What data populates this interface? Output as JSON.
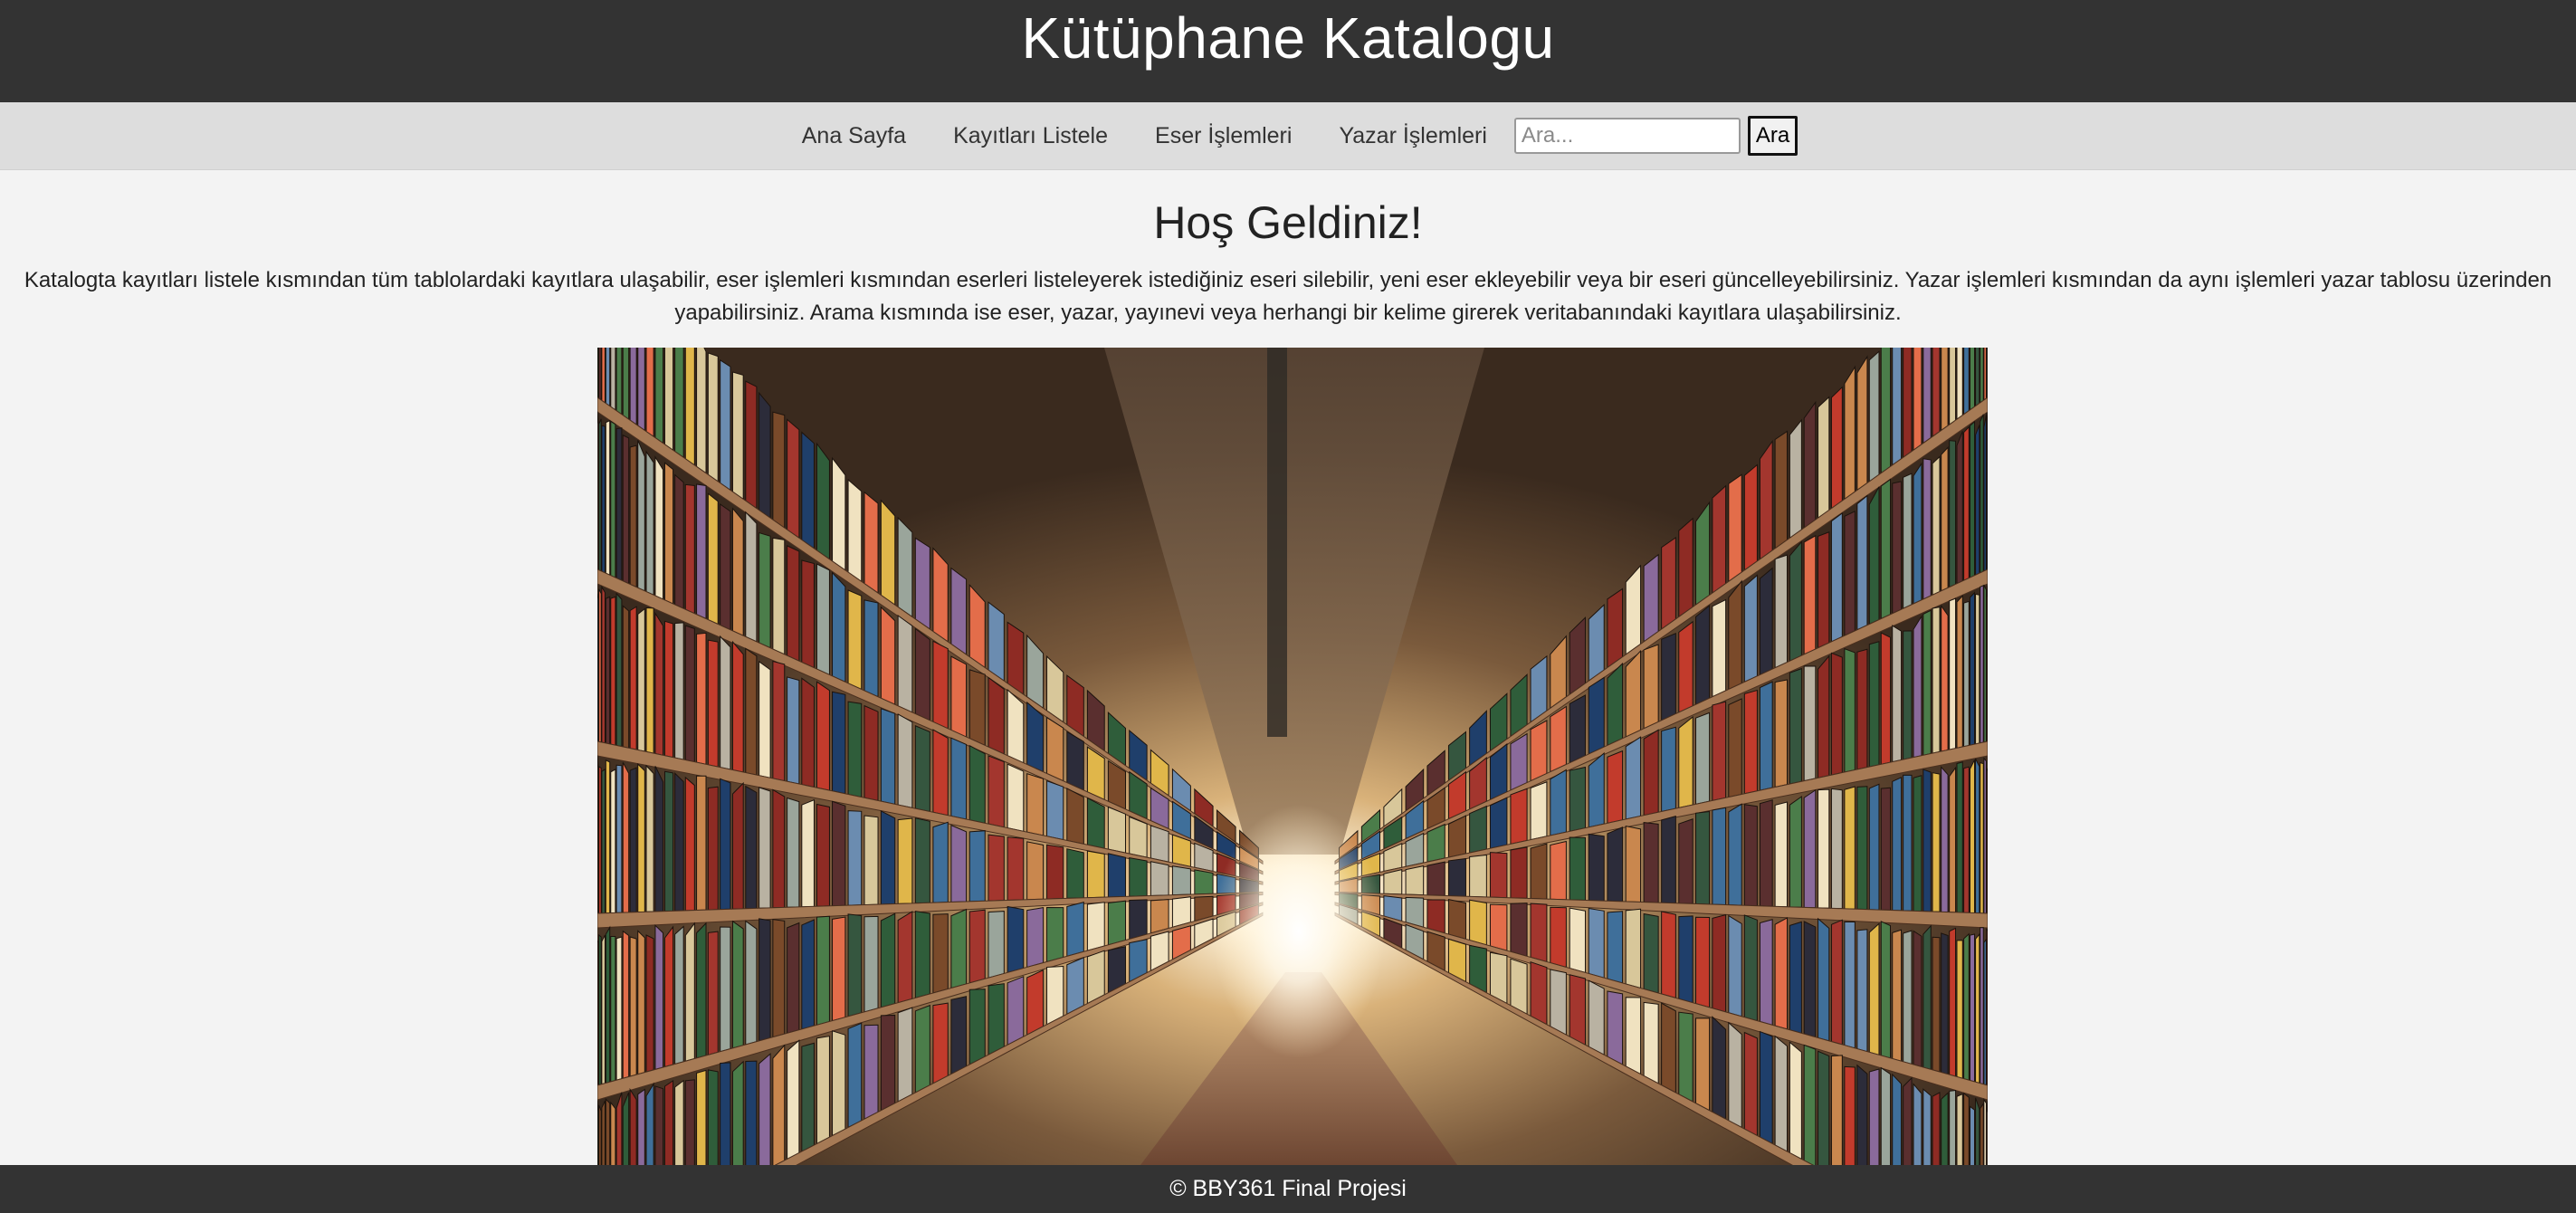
{
  "header": {
    "title": "Kütüphane Katalogu"
  },
  "nav": {
    "items": [
      {
        "label": "Ana Sayfa"
      },
      {
        "label": "Kayıtları Listele"
      },
      {
        "label": "Eser İşlemleri"
      },
      {
        "label": "Yazar İşlemleri"
      }
    ],
    "search": {
      "placeholder": "Ara...",
      "value": "",
      "button_label": "Ara"
    }
  },
  "main": {
    "heading": "Hoş Geldiniz!",
    "intro": "Katalogta kayıtları listele kısmından tüm tablolardaki kayıtlara ulaşabilir, eser işlemleri kısmından eserleri listeleyerek istediğiniz eseri silebilir, yeni eser ekleyebilir veya bir eseri güncelleyebilirsiniz. Yazar işlemleri kısmından da aynı işlemleri yazar tablosu üzerinden yapabilirsiniz. Arama kısmında ise eser, yazar, yayınevi veya herhangi bir kelime girerek veritabanındaki kayıtlara ulaşabilirsiniz.",
    "image_subject": "library-bookshelves-photo"
  },
  "footer": {
    "text": "© BBY361 Final Projesi"
  },
  "colors": {
    "header_bg": "#333333",
    "nav_bg": "#dddddd",
    "page_bg": "#f3f3f3",
    "footer_bg": "#333333"
  }
}
